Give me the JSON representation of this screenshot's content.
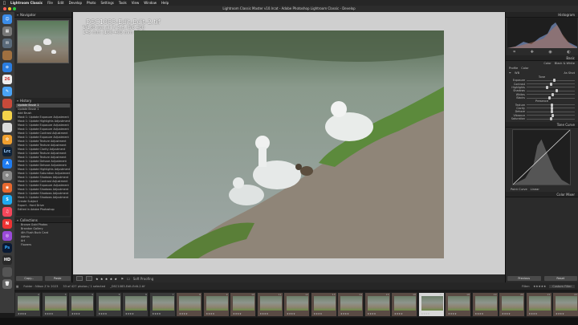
{
  "menubar": {
    "items": [
      "Lightroom Classic",
      "File",
      "Edit",
      "Develop",
      "Photo",
      "Settings",
      "Tools",
      "View",
      "Window",
      "Help"
    ],
    "datetime": "Mon Oct 16  8:46 PM"
  },
  "window": {
    "title": "Lightroom Classic Master v10.lrcat - Adobe Photoshop Lightroom Classic - Develop"
  },
  "photo": {
    "filename": "_DSC1083-Edit-Edit-2.tif",
    "exposure": "1/160 sec at f / 5.6, ISO 400",
    "lens": "145 mm (100-400 mm f/5.6)"
  },
  "left_panel": {
    "navigator_label": "Navigator",
    "history_label": "History",
    "collections_label": "Collections",
    "history_items": [
      "Update Brush 1",
      "Update Brush 1",
      "Add Brush",
      "Mask 1: Update Exposure Adjustment",
      "Mask 1: Update Highlights Adjustment",
      "Mask 1: Update Exposure Adjustment",
      "Mask 1: Update Exposure Adjustment",
      "Mask 1: Update Contrast Adjustment",
      "Mask 1: Update Exposure Adjustment",
      "Mask 1: Update Texture Adjustment",
      "Mask 1: Update Texture Adjustment",
      "Mask 1: Update Clarity Adjustment",
      "Mask 1: Update Texture Adjustment",
      "Mask 1: Update Texture Adjustment",
      "Mask 1: Update Dehaze Adjustment",
      "Mask 1: Update Dehaze Adjustment",
      "Mask 1: Update Highlights Adjustment",
      "Mask 1: Update Saturation Adjustment",
      "Mask 1: Update Shadows Adjustment",
      "Mask 1: Update Contrast Adjustment",
      "Mask 1: Update Exposure Adjustment",
      "Mask 1: Update Shadows Adjustment",
      "Mask 1: Update Shadows Adjustment",
      "Mask 1: Update Shadows Adjustment",
      "Create Subject",
      "Export - Hard Drive",
      "Edited in Adobe Photoshop"
    ],
    "collection_items": [
      "Bronze Gold Photos",
      "Brandon Gallery",
      "4th Flush Buck Card",
      "Admin",
      "Art",
      "Flowers"
    ],
    "copy_label": "Copy...",
    "paste_label": "Paste"
  },
  "right_panel": {
    "histogram_label": "Histogram",
    "basic_label": "Basic",
    "treatment": [
      "Color",
      "Black & White"
    ],
    "profile_label": "Profile",
    "profile_value": "Color",
    "wb_label": "WB",
    "wb_value": "As Shot",
    "tone_label": "Tone",
    "tone_sliders": [
      "Exposure",
      "Contrast",
      "Highlights",
      "Shadows",
      "Whites",
      "Blacks"
    ],
    "presence_label": "Presence",
    "presence_sliders": [
      "Texture",
      "Clarity",
      "Dehaze",
      "Vibrance",
      "Saturation"
    ],
    "tone_curve_label": "Tone Curve",
    "color_mixer_label": "Color Mixer",
    "point_curve_label": "Point Curve",
    "point_curve_value": "Linear",
    "previous_label": "Previous",
    "reset_label": "Reset"
  },
  "toolbar": {
    "soft_proofing": "Soft Proofing"
  },
  "filmstrip": {
    "source": "Folder : Nikon Z fc 2023",
    "count": "33 of 427 photos / 1 selected",
    "selected_file": "_DSC1083-Edit-Edit-2.tif",
    "filter_label": "Filter:",
    "filter_value": "Custom Filter",
    "thumbs": [
      {
        "num": "2",
        "tone": "normal"
      },
      {
        "num": "3",
        "tone": "normal"
      },
      {
        "num": "4",
        "tone": "normal"
      },
      {
        "num": "5",
        "tone": "normal"
      },
      {
        "num": "6",
        "tone": "normal"
      },
      {
        "num": "7",
        "tone": "normal"
      },
      {
        "num": "8",
        "tone": "warm"
      },
      {
        "num": "9",
        "tone": "warm"
      },
      {
        "num": "10",
        "tone": "warm"
      },
      {
        "num": "11",
        "tone": "warm"
      },
      {
        "num": "12",
        "tone": "warm"
      },
      {
        "num": "13",
        "tone": "warm"
      },
      {
        "num": "14",
        "tone": "warm"
      },
      {
        "num": "15",
        "tone": "warm"
      },
      {
        "num": "16",
        "tone": "warm"
      },
      {
        "num": "17",
        "tone": "sel"
      },
      {
        "num": "18",
        "tone": "warm"
      },
      {
        "num": "19",
        "tone": "warm"
      },
      {
        "num": "20",
        "tone": "warm"
      },
      {
        "num": "21",
        "tone": "warm"
      },
      {
        "num": "22",
        "tone": "warm"
      }
    ]
  }
}
